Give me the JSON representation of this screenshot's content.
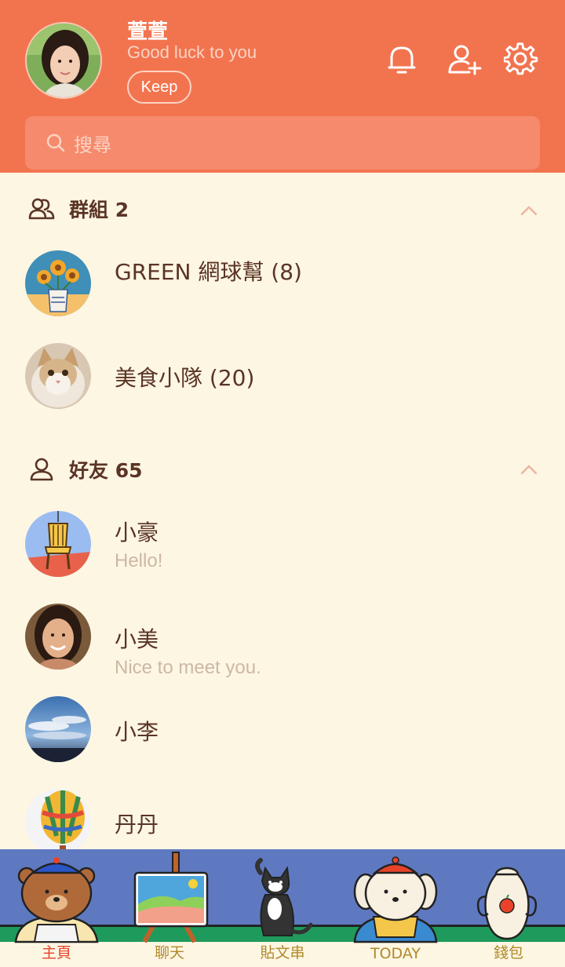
{
  "profile": {
    "name": "萱萱",
    "status": "Good luck to you",
    "keep_label": "Keep"
  },
  "header_icons": [
    "bell-icon",
    "add-friend-icon",
    "gear-icon"
  ],
  "search": {
    "placeholder": "搜尋"
  },
  "groups": {
    "title": "群組 2",
    "items": [
      {
        "name": "GREEN 網球幫 (8)"
      },
      {
        "name": "美食小隊 (20)"
      }
    ]
  },
  "friends": {
    "title": "好友 65",
    "items": [
      {
        "name": "小豪",
        "status": "Hello!"
      },
      {
        "name": "小美",
        "status": "Nice to meet you."
      },
      {
        "name": "小李",
        "status": ""
      },
      {
        "name": "丹丹",
        "status": ""
      }
    ]
  },
  "nav": {
    "items": [
      {
        "label": "主頁",
        "active": true
      },
      {
        "label": "聊天",
        "active": false
      },
      {
        "label": "貼文串",
        "active": false
      },
      {
        "label": "TODAY",
        "active": false
      },
      {
        "label": "錢包",
        "active": false
      }
    ]
  },
  "colors": {
    "header": "#f2744f",
    "background": "#fdf6e3",
    "text": "#5a3425",
    "nav_background": "#5f79c0",
    "active_tab": "#e8432a"
  }
}
